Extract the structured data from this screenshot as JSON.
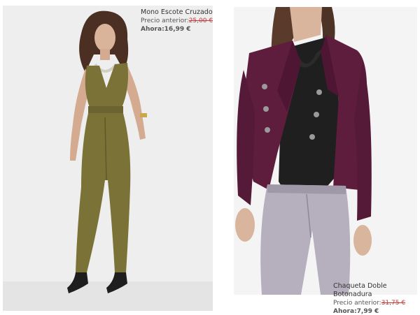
{
  "products": [
    {
      "name": "Mono Escote Cruzado",
      "previous_label": "Precio anterior:",
      "previous_price": "25,00 €",
      "now_label": "Ahora:",
      "now_price": "16,99 €",
      "garment_color": "#7a7236"
    },
    {
      "name": "Chaqueta Doble Botonadura",
      "previous_label": "Precio anterior:",
      "previous_price": "31,75 €",
      "now_label": "Ahora:",
      "now_price": "7,99 €",
      "garment_color": "#5e1d3d"
    }
  ]
}
